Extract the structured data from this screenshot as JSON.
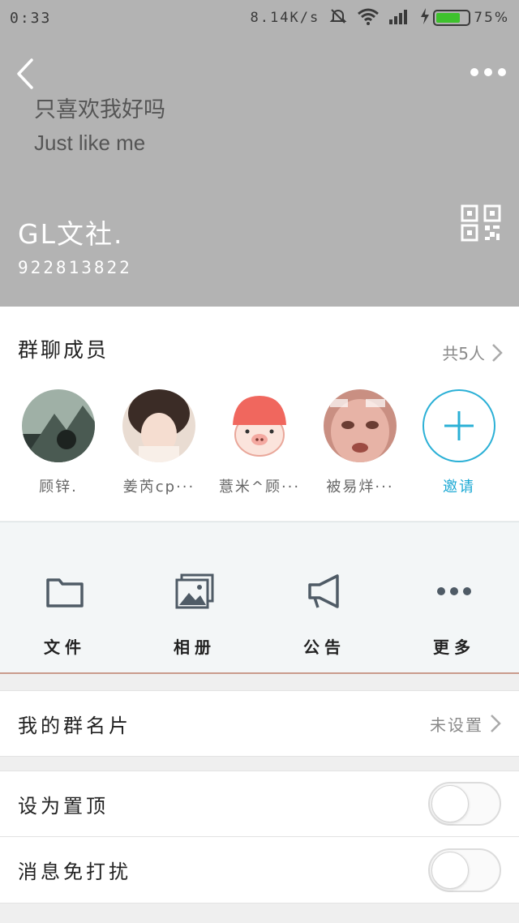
{
  "status_bar": {
    "time": "0:33",
    "network_speed": "8.14K/s",
    "battery_percent": "75%",
    "battery_level": 0.75,
    "icons": [
      "mute-icon",
      "wifi-icon",
      "signal-icon",
      "charging-icon",
      "battery-icon"
    ]
  },
  "header": {
    "slogan_line1": "只喜欢我好吗",
    "slogan_line2": "Just like me",
    "group_name": "GL文社.",
    "group_id": "922813822",
    "background_color": "#b3b3b3"
  },
  "members": {
    "title": "群聊成员",
    "count_label": "共5人",
    "list": [
      {
        "name": "顾锌."
      },
      {
        "name": "姜芮cp···"
      },
      {
        "name": "薏米^顾···"
      },
      {
        "name": "被易烊···"
      }
    ],
    "invite_label": "邀请"
  },
  "actions": [
    {
      "label": "文件",
      "icon": "folder-icon"
    },
    {
      "label": "相册",
      "icon": "album-icon"
    },
    {
      "label": "公告",
      "icon": "announcement-icon"
    },
    {
      "label": "更多",
      "icon": "more-icon"
    }
  ],
  "card": {
    "label": "我的群名片",
    "value": "未设置"
  },
  "settings": {
    "pin_label": "设为置顶",
    "pin_on": false,
    "mute_label": "消息免打扰",
    "mute_on": false
  },
  "colors": {
    "accent": "#1ca9d4",
    "battery": "#3ec22d"
  }
}
